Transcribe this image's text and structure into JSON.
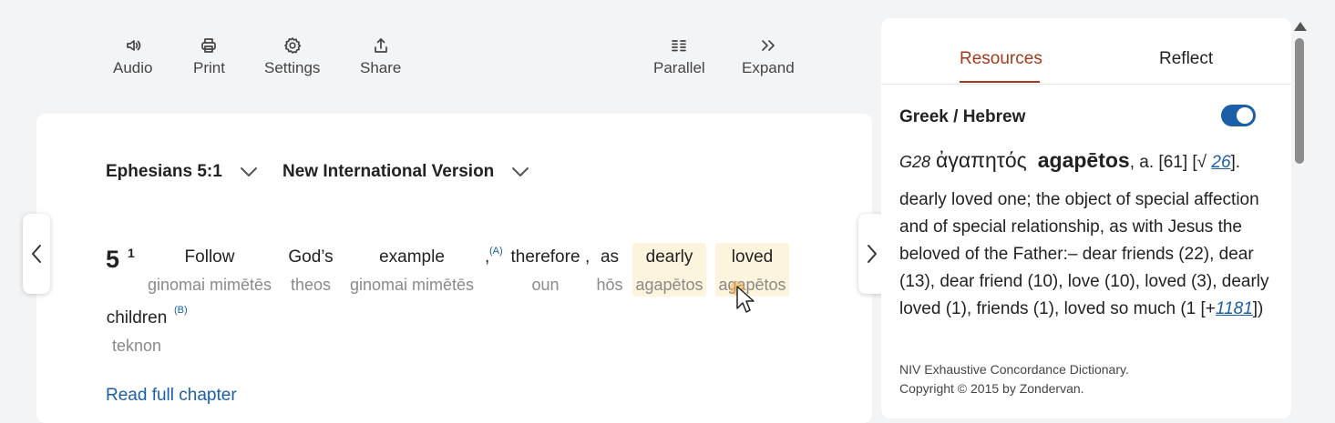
{
  "toolbar": {
    "audio": "Audio",
    "print": "Print",
    "settings": "Settings",
    "share": "Share",
    "parallel": "Parallel",
    "expand": "Expand"
  },
  "passage": {
    "reference": "Ephesians 5:1",
    "version": "New International Version",
    "chapter": "5",
    "verse": "1",
    "words": [
      {
        "en": "Follow",
        "gr": "ginomai mimētēs"
      },
      {
        "en": "God’s",
        "gr": "theos"
      },
      {
        "en": "example",
        "gr": "ginomai mimētēs"
      },
      {
        "en": "therefore",
        "gr": "oun"
      },
      {
        "en": "as",
        "gr": "hōs"
      },
      {
        "en": "dearly",
        "gr": "agapētos"
      },
      {
        "en": "loved",
        "gr": "agapētos"
      },
      {
        "en": "children",
        "gr": "teknon"
      }
    ],
    "footnote_a": "(A)",
    "footnote_b": "(B)",
    "comma": ",",
    "read_full_chapter": "Read full chapter"
  },
  "panel": {
    "tabs": [
      "Resources",
      "Reflect"
    ],
    "active_tab": "Resources",
    "toggle_label": "Greek / Hebrew",
    "toggle_on": true,
    "entry": {
      "number": "G28",
      "greek": "ἀγαπητός",
      "translit": "agapētos",
      "pos": ", a. [61] [√",
      "root_link": "26",
      "close": "].",
      "definition": "dearly loved one; the object of special affection and of special relationship, as with Jesus the beloved of the Father:– dear friends (22), dear (13), dear friend (10), love (10), loved (3), dearly loved (1), friends (1), loved so much (1 [+",
      "def_link": "1181",
      "def_close": "])"
    },
    "source_line1": "NIV Exhaustive Concordance Dictionary.",
    "source_line2": "Copyright © 2015 by Zondervan."
  },
  "colors": {
    "accent_tab": "#a43a1c",
    "link": "#1a5fa8",
    "highlight": "#fdf4dd",
    "toggle": "#1a5fa8"
  },
  "icons": [
    "audio-icon",
    "print-icon",
    "settings-icon",
    "share-icon",
    "parallel-icon",
    "expand-icon",
    "chevron-down-icon",
    "chevron-left-icon",
    "chevron-right-icon",
    "cursor-icon"
  ]
}
